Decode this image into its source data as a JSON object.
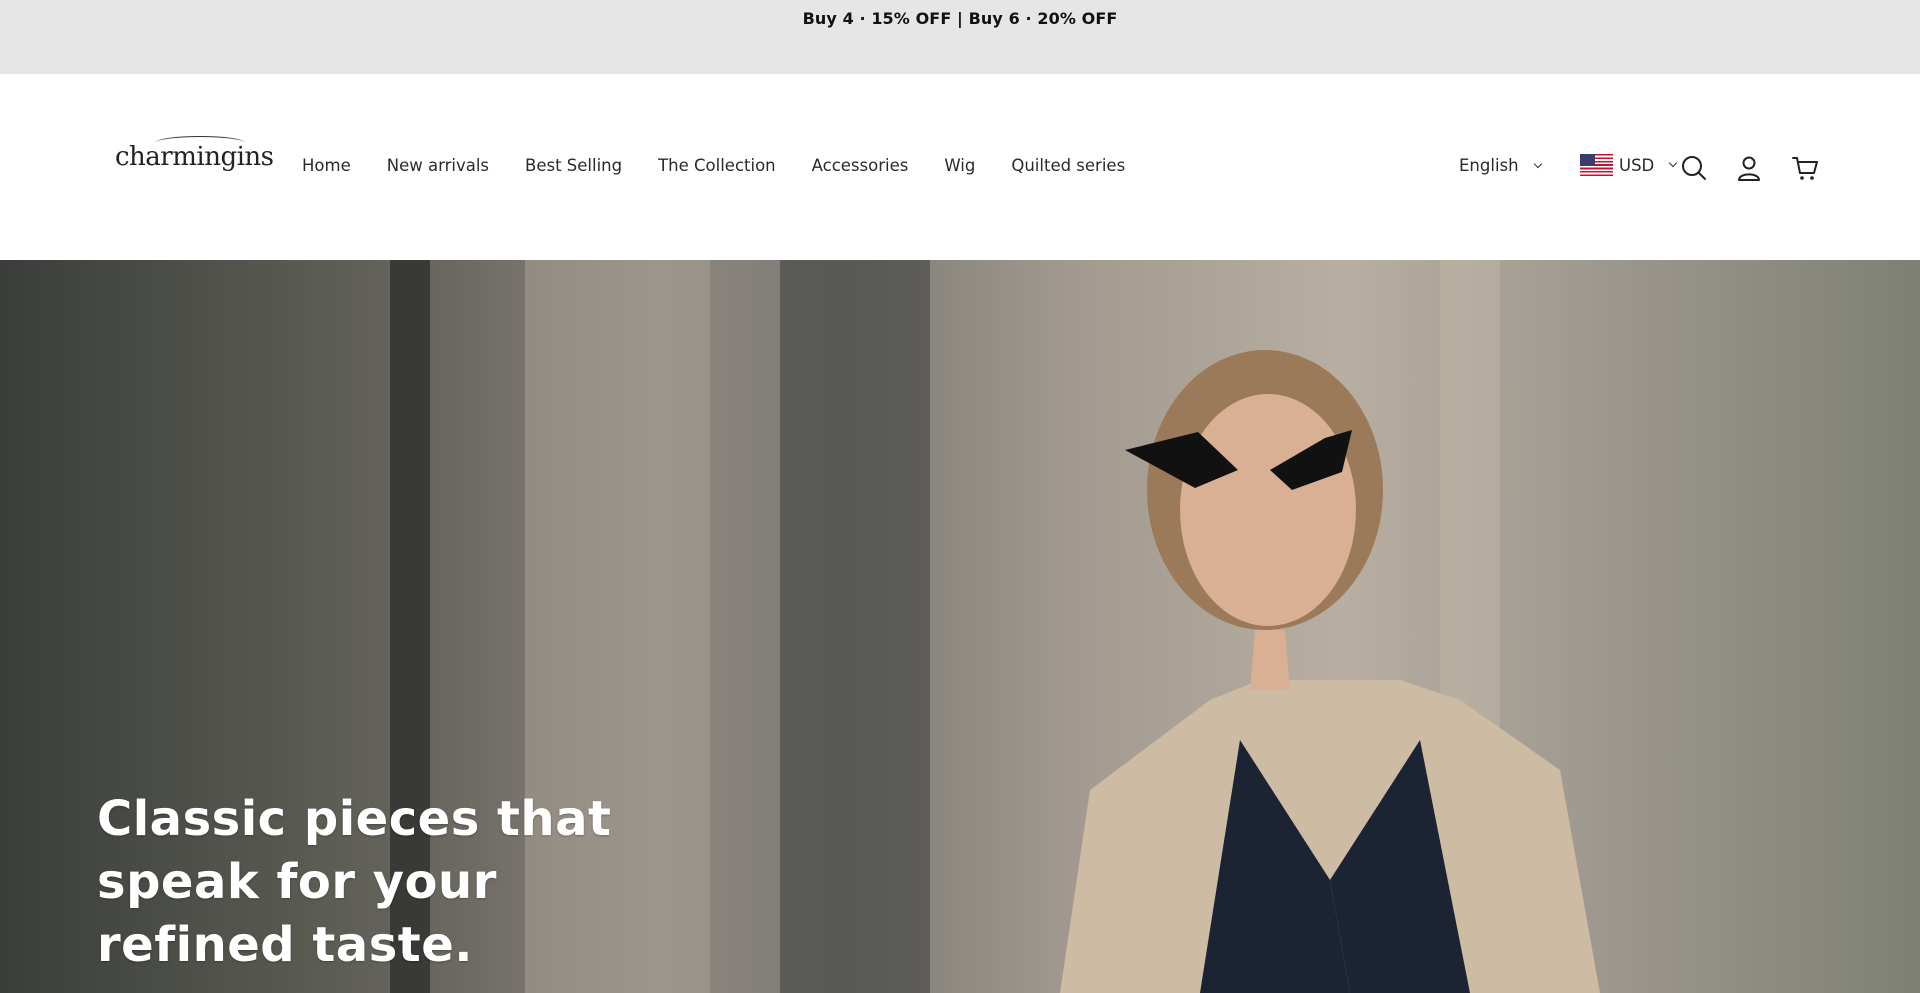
{
  "announcement": {
    "text": "Buy 4 · 15% OFF | Buy 6 · 20% OFF"
  },
  "header": {
    "logo_text": "charmingins",
    "nav_items": [
      {
        "label": "Home"
      },
      {
        "label": "New arrivals"
      },
      {
        "label": "Best Selling"
      },
      {
        "label": "The Collection"
      },
      {
        "label": "Accessories"
      },
      {
        "label": "Wig"
      },
      {
        "label": "Quilted series"
      }
    ],
    "language": "English",
    "currency": "USD",
    "icons": [
      "chevron-down-icon",
      "us-flag-icon",
      "search-icon",
      "account-icon",
      "cart-icon"
    ]
  },
  "hero": {
    "title": "Classic pieces that speak for your refined taste."
  },
  "colors": {
    "announcement_bg": "#e6e6e6",
    "header_bg": "#ffffff",
    "text": "#222222",
    "hero_text": "#ffffff"
  }
}
